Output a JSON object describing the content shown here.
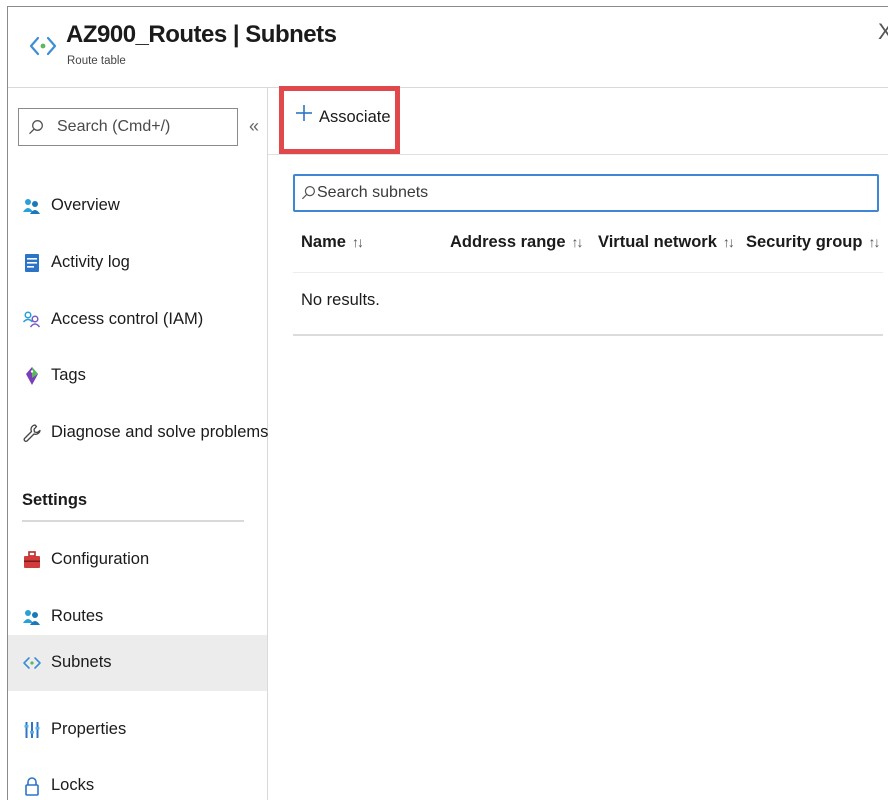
{
  "header": {
    "title": "AZ900_Routes | Subnets",
    "subtitle": "Route table",
    "icon": "route-table-icon",
    "close_glyph": "X"
  },
  "sidebar": {
    "search_placeholder": "Search (Cmd+/)",
    "collapse_glyph": "«",
    "items_top": [
      {
        "label": "Overview",
        "icon": "overview-icon"
      },
      {
        "label": "Activity log",
        "icon": "activity-log-icon"
      },
      {
        "label": "Access control (IAM)",
        "icon": "access-control-icon"
      },
      {
        "label": "Tags",
        "icon": "tag-icon"
      },
      {
        "label": "Diagnose and solve problems",
        "icon": "wrench-icon"
      }
    ],
    "section_settings": "Settings",
    "items_settings": [
      {
        "label": "Configuration",
        "icon": "toolbox-icon"
      },
      {
        "label": "Routes",
        "icon": "routes-icon"
      },
      {
        "label": "Subnets",
        "icon": "subnets-icon",
        "active": true
      },
      {
        "label": "Properties",
        "icon": "properties-icon"
      },
      {
        "label": "Locks",
        "icon": "lock-icon"
      }
    ]
  },
  "toolbar": {
    "associate_label": "Associate",
    "highlight_color": "#e0484b"
  },
  "main": {
    "search_placeholder": "Search subnets",
    "columns": [
      {
        "label": "Name"
      },
      {
        "label": "Address range"
      },
      {
        "label": "Virtual network"
      },
      {
        "label": "Security group"
      }
    ],
    "sort_glyph": "↑↓",
    "empty_text": "No results."
  },
  "colors": {
    "accent": "#0078d4",
    "search_border": "#3f86d4"
  }
}
